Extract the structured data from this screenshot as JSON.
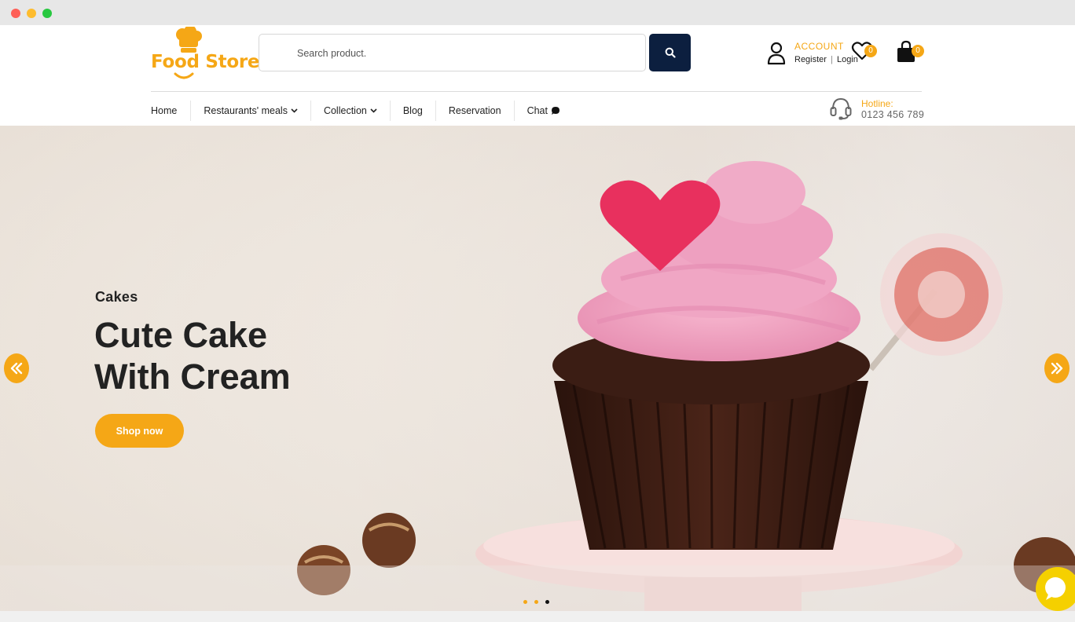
{
  "window": {
    "controls": [
      "close",
      "minimize",
      "maximize"
    ]
  },
  "header": {
    "logo_text": "Food Store",
    "search": {
      "placeholder": "Search product.",
      "button_icon": "search-icon"
    },
    "account": {
      "title": "ACCOUNT",
      "register_label": "Register",
      "separator": "|",
      "login_label": "Login"
    },
    "wishlist": {
      "count": "0"
    },
    "cart": {
      "count": "0"
    },
    "hotline": {
      "label": "Hotline:",
      "number": "0123 456 789"
    },
    "nav": [
      {
        "label": "Home"
      },
      {
        "label": "Restaurants' meals"
      },
      {
        "label": "Collection"
      },
      {
        "label": "Blog"
      },
      {
        "label": "Reservation"
      },
      {
        "label": "Chat"
      }
    ]
  },
  "banner": {
    "subtitle": "Cakes",
    "title_line1": "Cute Cake",
    "title_line2": "With Cream",
    "button_label": "Shop now",
    "slides_count": 3,
    "active_slide": 3
  },
  "colors": {
    "accent": "#f5a716",
    "dark": "#0c1f3f",
    "text": "#222222",
    "chat": "#f5d000"
  }
}
